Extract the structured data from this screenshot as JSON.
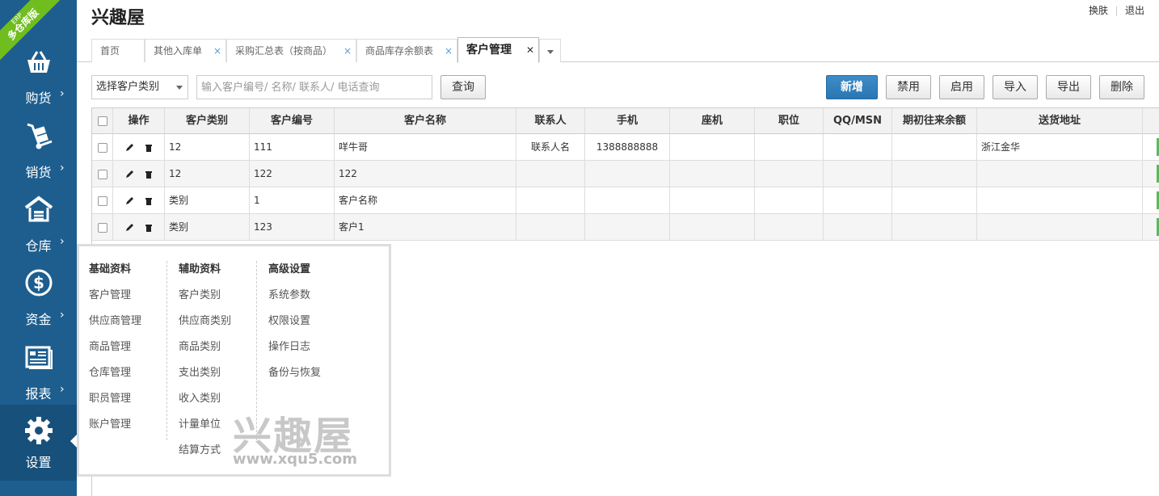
{
  "app": {
    "title": "兴趣屋",
    "badge_small": "ERP",
    "badge_big": "多仓库版"
  },
  "top_links": {
    "skin": "换肤",
    "logout": "退出"
  },
  "sidebar": {
    "items": [
      {
        "label": "购货",
        "icon": "shopping-basket-icon"
      },
      {
        "label": "销货",
        "icon": "hand-truck-icon"
      },
      {
        "label": "仓库",
        "icon": "warehouse-icon"
      },
      {
        "label": "资金",
        "icon": "dollar-icon"
      },
      {
        "label": "报表",
        "icon": "report-icon"
      },
      {
        "label": "设置",
        "icon": "gear-icon"
      }
    ],
    "arrow": "›"
  },
  "tabs": [
    {
      "label": "首页"
    },
    {
      "label": "其他入库单",
      "close": "×"
    },
    {
      "label": "采购汇总表（按商品）",
      "close": "×"
    },
    {
      "label": "商品库存余额表",
      "close": "×"
    },
    {
      "label": "客户管理",
      "close": "✕"
    }
  ],
  "toolbar": {
    "category_select": "选择客户类别",
    "search_placeholder": "输入客户编号/ 名称/ 联系人/ 电话查询",
    "query": "查询",
    "add": "新增",
    "disable": "禁用",
    "enable": "启用",
    "import": "导入",
    "export": "导出",
    "delete": "删除"
  },
  "grid": {
    "columns": [
      "操作",
      "客户类别",
      "客户编号",
      "客户名称",
      "联系人",
      "手机",
      "座机",
      "职位",
      "QQ/MSN",
      "期初往来余额",
      "送货地址"
    ],
    "rows": [
      {
        "category": "12",
        "code": "111",
        "name": "咩牛哥",
        "contact": "联系人名",
        "mobile": "1388888888",
        "phone": "",
        "position": "",
        "qq": "",
        "balance": "",
        "address": "浙江金华"
      },
      {
        "category": "12",
        "code": "122",
        "name": "122",
        "contact": "",
        "mobile": "",
        "phone": "",
        "position": "",
        "qq": "",
        "balance": "",
        "address": ""
      },
      {
        "category": "类别",
        "code": "1",
        "name": "客户名称",
        "contact": "",
        "mobile": "",
        "phone": "",
        "position": "",
        "qq": "",
        "balance": "",
        "address": ""
      },
      {
        "category": "类别",
        "code": "123",
        "name": "客户1",
        "contact": "",
        "mobile": "",
        "phone": "",
        "position": "",
        "qq": "",
        "balance": "",
        "address": ""
      }
    ]
  },
  "settings_menu": {
    "columns": [
      {
        "title": "基础资料",
        "items": [
          "客户管理",
          "供应商管理",
          "商品管理",
          "仓库管理",
          "职员管理",
          "账户管理"
        ]
      },
      {
        "title": "辅助资料",
        "items": [
          "客户类别",
          "供应商类别",
          "商品类别",
          "支出类别",
          "收入类别",
          "计量单位",
          "结算方式"
        ]
      },
      {
        "title": "高级设置",
        "items": [
          "系统参数",
          "权限设置",
          "操作日志",
          "备份与恢复"
        ]
      }
    ]
  },
  "watermark": {
    "text": "兴趣屋",
    "url": "www.xqu5.com"
  },
  "colors": {
    "sidebar": "#1d5e8f",
    "sidebar_active": "#17507b",
    "primary_button": "#2b76b1",
    "badge": "#6fbd1f",
    "row_flag": "#5cb85c"
  }
}
